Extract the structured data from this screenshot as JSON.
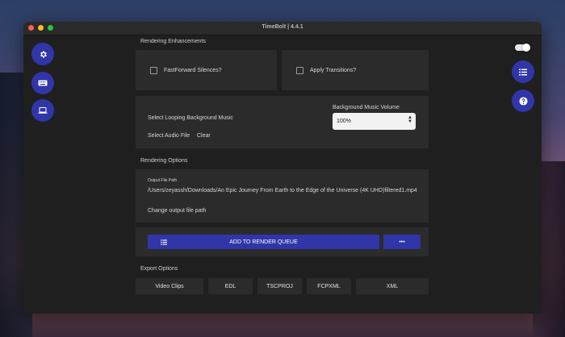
{
  "window": {
    "title": "TimeBolt | 4.4.1"
  },
  "traffic_lights": {
    "close": "#fe5f57",
    "minimize": "#febc2e",
    "zoom": "#28c840"
  },
  "colors": {
    "accent": "#3035a8",
    "panel": "#2b2b2b",
    "window_bg": "#1f1f1f"
  },
  "left_sidebar": {
    "buttons": [
      {
        "icon": "gear-icon"
      },
      {
        "icon": "keyboard-icon"
      },
      {
        "icon": "laptop-icon"
      }
    ]
  },
  "right_sidebar": {
    "toggle_on": true,
    "buttons": [
      {
        "icon": "list-icon"
      },
      {
        "icon": "help-icon"
      }
    ]
  },
  "rendering_enhancements": {
    "heading": "Rendering Enhancements",
    "fastforward_label": "FastForward Silences?",
    "fastforward_checked": false,
    "transitions_label": "Apply Transitions?",
    "transitions_checked": false
  },
  "music": {
    "looping_label": "Select Looping Background Music",
    "select_audio_label": "Select Audio File",
    "clear_label": "Clear",
    "volume_label": "Background Music Volume",
    "volume_value": "100%"
  },
  "rendering_options": {
    "heading": "Rendering Options",
    "output_label": "Output File Path",
    "output_path": "/Users/zeyassh/Downloads/An Epic Journey From Earth to the Edge of the Universe (4K UHD)filtered1.mp4",
    "change_label": "Change output file path"
  },
  "queue": {
    "add_label": "ADD TO RENDER QUEUE",
    "more_label": "•••"
  },
  "export": {
    "heading": "Export Options",
    "buttons": [
      "Video Clips",
      "EDL",
      "TSCPROJ",
      "FCPXML",
      "XML"
    ]
  }
}
